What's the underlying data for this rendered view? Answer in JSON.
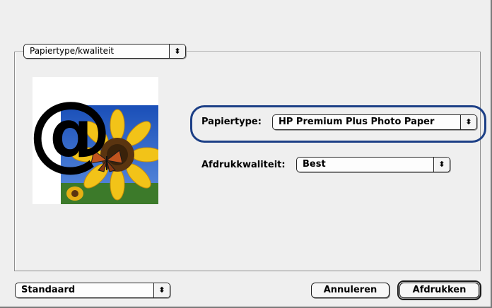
{
  "section_popup": {
    "value": "Papiertype/kwaliteit"
  },
  "papiertype": {
    "label": "Papiertype:",
    "value": "HP Premium Plus Photo Paper"
  },
  "afdrukkwaliteit": {
    "label": "Afdrukkwaliteit:",
    "value": "Best"
  },
  "preset_popup": {
    "value": "Standaard"
  },
  "buttons": {
    "cancel": "Annuleren",
    "print": "Afdrukken"
  },
  "preview": {
    "symbol": "@",
    "image": "sunflower-butterfly-photo"
  },
  "icons": {
    "popup_arrows": "up-down-arrows-icon"
  },
  "colors": {
    "highlight": "#1c3f86",
    "sky": "#2a63c8",
    "petal": "#f2c318"
  }
}
